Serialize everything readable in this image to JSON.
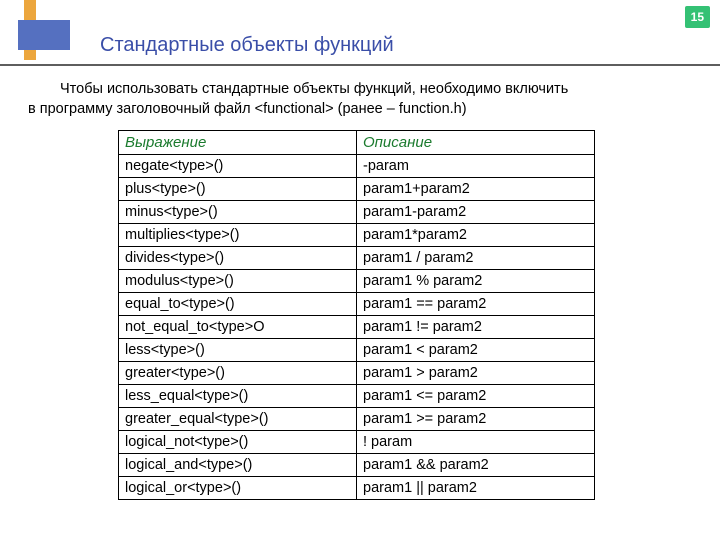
{
  "page_number": "15",
  "title": "Стандартные объекты функций",
  "intro_line1": "Чтобы использовать стандартные объекты функций, необходимо включить",
  "intro_line2": "в программу заголовочный файл <functional> (ранее – function.h)",
  "table": {
    "headers": {
      "c1": "Выражение",
      "c2": "Описание"
    },
    "rows": [
      {
        "c1": "negate<type>()",
        "c2": "-param"
      },
      {
        "c1": "plus<type>()",
        "c2": "param1+param2"
      },
      {
        "c1": "minus<type>()",
        "c2": "param1-param2"
      },
      {
        "c1": "multiplies<type>()",
        "c2": "param1*param2"
      },
      {
        "c1": "divides<type>()",
        "c2": "param1 / param2"
      },
      {
        "c1": "modulus<type>()",
        "c2": "param1 % param2"
      },
      {
        "c1": "equal_to<type>()",
        "c2": "param1 == param2"
      },
      {
        "c1": "not_equal_to<type>O",
        "c2": "param1 != param2"
      },
      {
        "c1": "less<type>()",
        "c2": "param1 < param2"
      },
      {
        "c1": "greater<type>()",
        "c2": "param1 > param2"
      },
      {
        "c1": "less_equal<type>()",
        "c2": "param1 <= param2"
      },
      {
        "c1": "greater_equal<type>()",
        "c2": "param1 >= param2"
      },
      {
        "c1": "logical_not<type>()",
        "c2": "! param"
      },
      {
        "c1": "logical_and<type>()",
        "c2": "param1 && param2"
      },
      {
        "c1": "logical_or<type>()",
        "c2": "param1 || param2"
      }
    ]
  }
}
